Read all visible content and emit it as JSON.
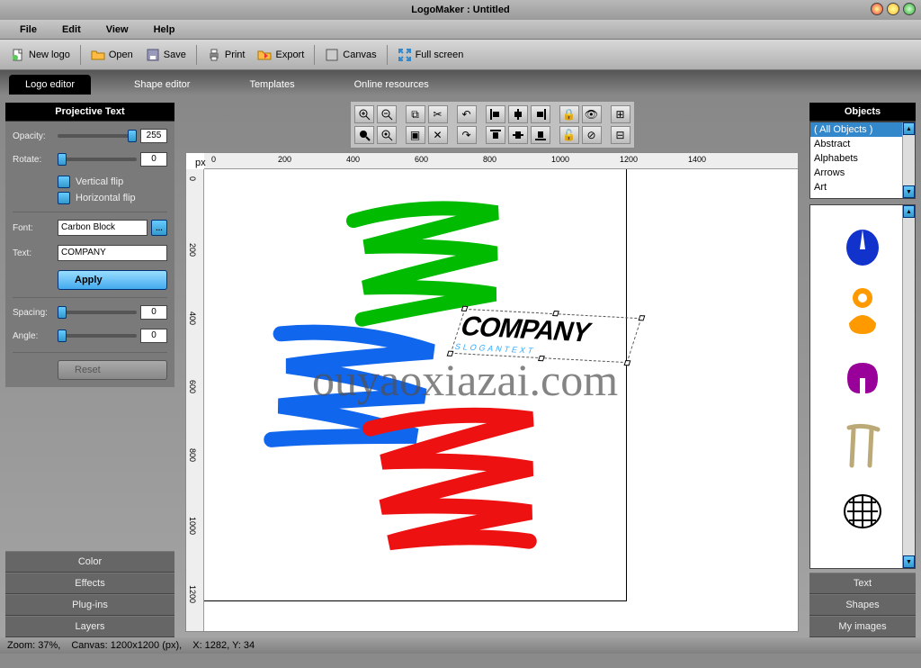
{
  "title": "LogoMaker : Untitled",
  "menu": {
    "file": "File",
    "edit": "Edit",
    "view": "View",
    "help": "Help"
  },
  "toolbar": {
    "newLogo": "New logo",
    "open": "Open",
    "save": "Save",
    "print": "Print",
    "export": "Export",
    "canvas": "Canvas",
    "fullscreen": "Full screen"
  },
  "tabs": {
    "logoEditor": "Logo editor",
    "shapeEditor": "Shape editor",
    "templates": "Templates",
    "onlineResources": "Online resources"
  },
  "left": {
    "header": "Projective Text",
    "opacity": {
      "label": "Opacity:",
      "value": "255"
    },
    "rotate": {
      "label": "Rotate:",
      "value": "0"
    },
    "vflip": "Vertical flip",
    "hflip": "Horizontal flip",
    "fontLabel": "Font:",
    "fontValue": "Carbon Block",
    "textLabel": "Text:",
    "textValue": "COMPANY",
    "apply": "Apply",
    "spacing": {
      "label": "Spacing:",
      "value": "0"
    },
    "angle": {
      "label": "Angle:",
      "value": "0"
    },
    "reset": "Reset",
    "accordion": [
      "Color",
      "Effects",
      "Plug-ins",
      "Layers"
    ]
  },
  "ruler": {
    "h": [
      "0",
      "200",
      "400",
      "600",
      "800",
      "1000",
      "1200",
      "1400"
    ],
    "v": [
      "0",
      "200",
      "400",
      "600",
      "800",
      "1000",
      "1200"
    ]
  },
  "canvasText": {
    "main": "COMPANY",
    "sub": "SLOGANTEXT"
  },
  "watermark": "ouyaoxiazai.com",
  "right": {
    "header": "Objects",
    "categories": [
      "( All Objects )",
      "Abstract",
      "Alphabets",
      "Arrows",
      "Art"
    ],
    "accordion": [
      "Text",
      "Shapes",
      "My images"
    ]
  },
  "status": {
    "zoom": "Zoom: 37%,",
    "canvas": "Canvas: 1200x1200 (px),",
    "coords": "X: 1282, Y: 34"
  }
}
